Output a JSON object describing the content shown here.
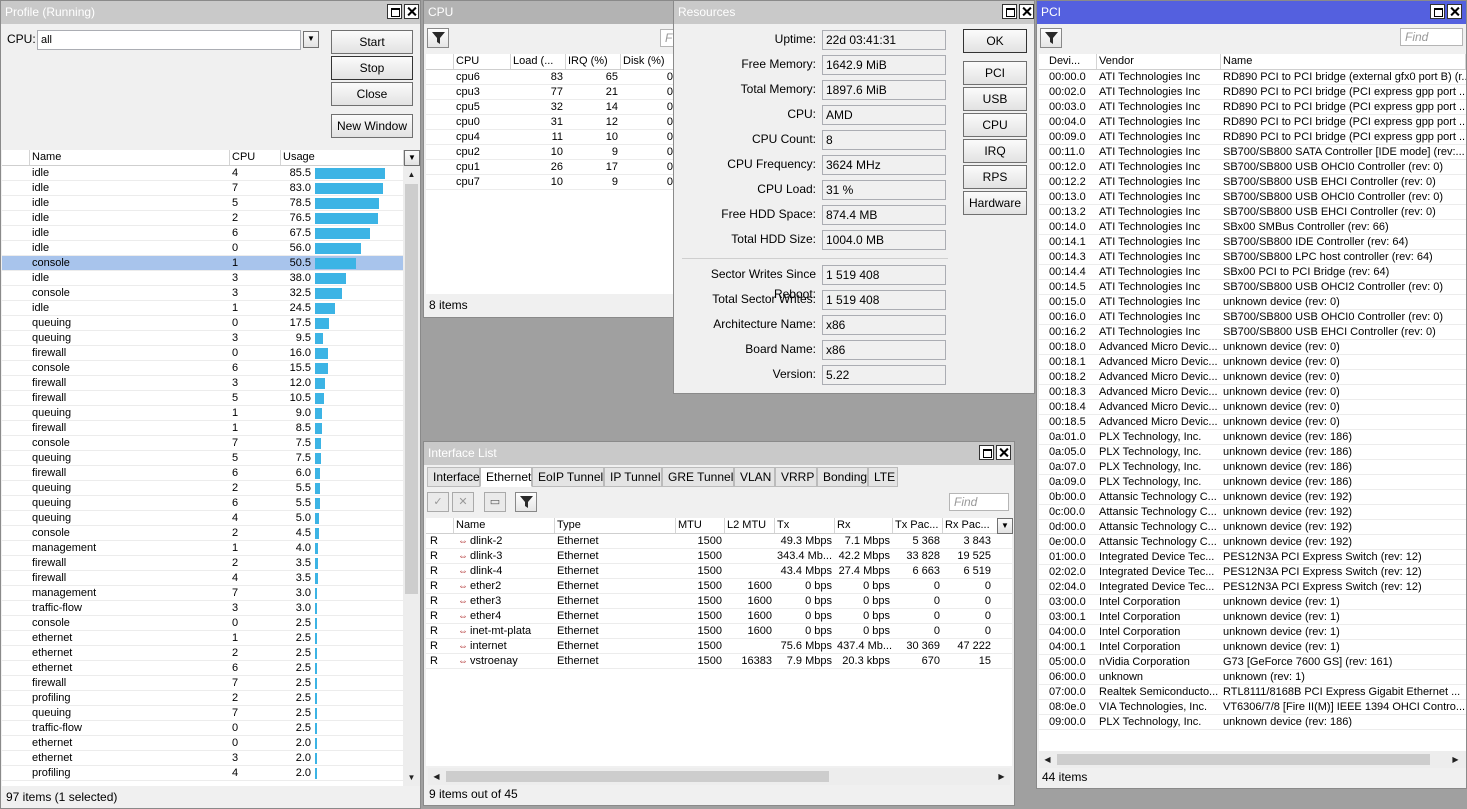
{
  "profile": {
    "title": "Profile (Running)",
    "cpu_label": "CPU:",
    "cpu_value": "all",
    "buttons": {
      "start": "Start",
      "stop": "Stop",
      "close": "Close",
      "new_window": "New Window"
    },
    "columns": [
      "Name",
      "CPU",
      "Usage"
    ],
    "rows": [
      [
        "idle",
        "4",
        "85.5"
      ],
      [
        "idle",
        "7",
        "83.0"
      ],
      [
        "idle",
        "5",
        "78.5"
      ],
      [
        "idle",
        "2",
        "76.5"
      ],
      [
        "idle",
        "6",
        "67.5"
      ],
      [
        "idle",
        "0",
        "56.0"
      ],
      [
        "console",
        "1",
        "50.5"
      ],
      [
        "idle",
        "3",
        "38.0"
      ],
      [
        "console",
        "3",
        "32.5"
      ],
      [
        "idle",
        "1",
        "24.5"
      ],
      [
        "queuing",
        "0",
        "17.5"
      ],
      [
        "queuing",
        "3",
        "9.5"
      ],
      [
        "firewall",
        "0",
        "16.0"
      ],
      [
        "console",
        "6",
        "15.5"
      ],
      [
        "firewall",
        "3",
        "12.0"
      ],
      [
        "firewall",
        "5",
        "10.5"
      ],
      [
        "queuing",
        "1",
        "9.0"
      ],
      [
        "firewall",
        "1",
        "8.5"
      ],
      [
        "console",
        "7",
        "7.5"
      ],
      [
        "queuing",
        "5",
        "7.5"
      ],
      [
        "firewall",
        "6",
        "6.0"
      ],
      [
        "queuing",
        "2",
        "5.5"
      ],
      [
        "queuing",
        "6",
        "5.5"
      ],
      [
        "queuing",
        "4",
        "5.0"
      ],
      [
        "console",
        "2",
        "4.5"
      ],
      [
        "management",
        "1",
        "4.0"
      ],
      [
        "firewall",
        "2",
        "3.5"
      ],
      [
        "firewall",
        "4",
        "3.5"
      ],
      [
        "management",
        "7",
        "3.0"
      ],
      [
        "traffic-flow",
        "3",
        "3.0"
      ],
      [
        "console",
        "0",
        "2.5"
      ],
      [
        "ethernet",
        "1",
        "2.5"
      ],
      [
        "ethernet",
        "2",
        "2.5"
      ],
      [
        "ethernet",
        "6",
        "2.5"
      ],
      [
        "firewall",
        "7",
        "2.5"
      ],
      [
        "profiling",
        "2",
        "2.5"
      ],
      [
        "queuing",
        "7",
        "2.5"
      ],
      [
        "traffic-flow",
        "0",
        "2.5"
      ],
      [
        "ethernet",
        "0",
        "2.0"
      ],
      [
        "ethernet",
        "3",
        "2.0"
      ],
      [
        "profiling",
        "4",
        "2.0"
      ]
    ],
    "status": "97 items (1 selected)"
  },
  "cpu": {
    "title": "CPU",
    "columns": [
      "CPU",
      "Load (...",
      "IRQ (%)",
      "Disk (%)"
    ],
    "rows": [
      [
        "cpu6",
        "83",
        "65",
        "0"
      ],
      [
        "cpu3",
        "77",
        "21",
        "0"
      ],
      [
        "cpu5",
        "32",
        "14",
        "0"
      ],
      [
        "cpu0",
        "31",
        "12",
        "0"
      ],
      [
        "cpu4",
        "11",
        "10",
        "0"
      ],
      [
        "cpu2",
        "10",
        "9",
        "0"
      ],
      [
        "cpu1",
        "26",
        "17",
        "0"
      ],
      [
        "cpu7",
        "10",
        "9",
        "0"
      ]
    ],
    "status": "8 items"
  },
  "resources": {
    "title": "Resources",
    "fields": [
      [
        "Uptime:",
        "22d 03:41:31"
      ],
      [
        "Free Memory:",
        "1642.9 MiB"
      ],
      [
        "Total Memory:",
        "1897.6 MiB"
      ],
      [
        "CPU:",
        "AMD"
      ],
      [
        "CPU Count:",
        "8"
      ],
      [
        "CPU Frequency:",
        "3624 MHz"
      ],
      [
        "CPU Load:",
        "31 %"
      ],
      [
        "Free HDD Space:",
        "874.4 MB"
      ],
      [
        "Total HDD Size:",
        "1004.0 MB"
      ]
    ],
    "fields2": [
      [
        "Sector Writes Since Reboot:",
        "1 519 408"
      ],
      [
        "Total Sector Writes:",
        "1 519 408"
      ],
      [
        "Architecture Name:",
        "x86"
      ],
      [
        "Board Name:",
        "x86"
      ],
      [
        "Version:",
        "5.22"
      ]
    ],
    "buttons": [
      "OK",
      "PCI",
      "USB",
      "CPU",
      "IRQ",
      "RPS",
      "Hardware"
    ]
  },
  "pci": {
    "title": "PCI",
    "find_placeholder": "Find",
    "columns": [
      "Devi...",
      "Vendor",
      "Name"
    ],
    "rows": [
      [
        "00:00.0",
        "ATI Technologies Inc",
        "RD890 PCI to PCI bridge (external gfx0 port B) (r..."
      ],
      [
        "00:02.0",
        "ATI Technologies Inc",
        "RD890 PCI to PCI bridge (PCI express gpp port ..."
      ],
      [
        "00:03.0",
        "ATI Technologies Inc",
        "RD890 PCI to PCI bridge (PCI express gpp port ..."
      ],
      [
        "00:04.0",
        "ATI Technologies Inc",
        "RD890 PCI to PCI bridge (PCI express gpp port ..."
      ],
      [
        "00:09.0",
        "ATI Technologies Inc",
        "RD890 PCI to PCI bridge (PCI express gpp port ..."
      ],
      [
        "00:11.0",
        "ATI Technologies Inc",
        "SB700/SB800 SATA Controller [IDE mode] (rev:..."
      ],
      [
        "00:12.0",
        "ATI Technologies Inc",
        "SB700/SB800 USB OHCI0 Controller (rev: 0)"
      ],
      [
        "00:12.2",
        "ATI Technologies Inc",
        "SB700/SB800 USB EHCI Controller (rev: 0)"
      ],
      [
        "00:13.0",
        "ATI Technologies Inc",
        "SB700/SB800 USB OHCI0 Controller (rev: 0)"
      ],
      [
        "00:13.2",
        "ATI Technologies Inc",
        "SB700/SB800 USB EHCI Controller (rev: 0)"
      ],
      [
        "00:14.0",
        "ATI Technologies Inc",
        "SBx00 SMBus Controller (rev: 66)"
      ],
      [
        "00:14.1",
        "ATI Technologies Inc",
        "SB700/SB800 IDE Controller (rev: 64)"
      ],
      [
        "00:14.3",
        "ATI Technologies Inc",
        "SB700/SB800 LPC host controller (rev: 64)"
      ],
      [
        "00:14.4",
        "ATI Technologies Inc",
        "SBx00 PCI to PCI Bridge (rev: 64)"
      ],
      [
        "00:14.5",
        "ATI Technologies Inc",
        "SB700/SB800 USB OHCI2 Controller (rev: 0)"
      ],
      [
        "00:15.0",
        "ATI Technologies Inc",
        "unknown device (rev: 0)"
      ],
      [
        "00:16.0",
        "ATI Technologies Inc",
        "SB700/SB800 USB OHCI0 Controller (rev: 0)"
      ],
      [
        "00:16.2",
        "ATI Technologies Inc",
        "SB700/SB800 USB EHCI Controller (rev: 0)"
      ],
      [
        "00:18.0",
        "Advanced Micro Devic...",
        "unknown device (rev: 0)"
      ],
      [
        "00:18.1",
        "Advanced Micro Devic...",
        "unknown device (rev: 0)"
      ],
      [
        "00:18.2",
        "Advanced Micro Devic...",
        "unknown device (rev: 0)"
      ],
      [
        "00:18.3",
        "Advanced Micro Devic...",
        "unknown device (rev: 0)"
      ],
      [
        "00:18.4",
        "Advanced Micro Devic...",
        "unknown device (rev: 0)"
      ],
      [
        "00:18.5",
        "Advanced Micro Devic...",
        "unknown device (rev: 0)"
      ],
      [
        "0a:01.0",
        "PLX Technology, Inc.",
        "unknown device (rev: 186)"
      ],
      [
        "0a:05.0",
        "PLX Technology, Inc.",
        "unknown device (rev: 186)"
      ],
      [
        "0a:07.0",
        "PLX Technology, Inc.",
        "unknown device (rev: 186)"
      ],
      [
        "0a:09.0",
        "PLX Technology, Inc.",
        "unknown device (rev: 186)"
      ],
      [
        "0b:00.0",
        "Attansic Technology C...",
        "unknown device (rev: 192)"
      ],
      [
        "0c:00.0",
        "Attansic Technology C...",
        "unknown device (rev: 192)"
      ],
      [
        "0d:00.0",
        "Attansic Technology C...",
        "unknown device (rev: 192)"
      ],
      [
        "0e:00.0",
        "Attansic Technology C...",
        "unknown device (rev: 192)"
      ],
      [
        "01:00.0",
        "Integrated Device Tec...",
        "PES12N3A PCI Express Switch (rev: 12)"
      ],
      [
        "02:02.0",
        "Integrated Device Tec...",
        "PES12N3A PCI Express Switch (rev: 12)"
      ],
      [
        "02:04.0",
        "Integrated Device Tec...",
        "PES12N3A PCI Express Switch (rev: 12)"
      ],
      [
        "03:00.0",
        "Intel Corporation",
        "unknown device (rev: 1)"
      ],
      [
        "03:00.1",
        "Intel Corporation",
        "unknown device (rev: 1)"
      ],
      [
        "04:00.0",
        "Intel Corporation",
        "unknown device (rev: 1)"
      ],
      [
        "04:00.1",
        "Intel Corporation",
        "unknown device (rev: 1)"
      ],
      [
        "05:00.0",
        "nVidia Corporation",
        "G73 [GeForce 7600 GS] (rev: 161)"
      ],
      [
        "06:00.0",
        "unknown",
        "unknown (rev: 1)"
      ],
      [
        "07:00.0",
        "Realtek Semiconducto...",
        "RTL8111/8168B PCI Express Gigabit Ethernet ..."
      ],
      [
        "08:0e.0",
        "VIA Technologies, Inc.",
        "VT6306/7/8 [Fire II(M)] IEEE 1394 OHCI Contro..."
      ],
      [
        "09:00.0",
        "PLX Technology, Inc.",
        "unknown device (rev: 186)"
      ]
    ],
    "status": "44 items"
  },
  "iface": {
    "title": "Interface List",
    "tabs": [
      "Interface",
      "Ethernet",
      "EoIP Tunnel",
      "IP Tunnel",
      "GRE Tunnel",
      "VLAN",
      "VRRP",
      "Bonding",
      "LTE"
    ],
    "find_placeholder": "Find",
    "columns": [
      "Name",
      "Type",
      "MTU",
      "L2 MTU",
      "Tx",
      "Rx",
      "Tx Pac...",
      "Rx Pac..."
    ],
    "rows": [
      [
        "R",
        "dlink-2",
        "Ethernet",
        "1500",
        "",
        "49.3 Mbps",
        "7.1 Mbps",
        "5 368",
        "3 843"
      ],
      [
        "R",
        "dlink-3",
        "Ethernet",
        "1500",
        "",
        "343.4 Mb...",
        "42.2 Mbps",
        "33 828",
        "19 525"
      ],
      [
        "R",
        "dlink-4",
        "Ethernet",
        "1500",
        "",
        "43.4 Mbps",
        "27.4 Mbps",
        "6 663",
        "6 519"
      ],
      [
        "R",
        "ether2",
        "Ethernet",
        "1500",
        "1600",
        "0 bps",
        "0 bps",
        "0",
        "0"
      ],
      [
        "R",
        "ether3",
        "Ethernet",
        "1500",
        "1600",
        "0 bps",
        "0 bps",
        "0",
        "0"
      ],
      [
        "R",
        "ether4",
        "Ethernet",
        "1500",
        "1600",
        "0 bps",
        "0 bps",
        "0",
        "0"
      ],
      [
        "R",
        "inet-mt-plata",
        "Ethernet",
        "1500",
        "1600",
        "0 bps",
        "0 bps",
        "0",
        "0"
      ],
      [
        "R",
        "internet",
        "Ethernet",
        "1500",
        "",
        "75.6 Mbps",
        "437.4 Mb...",
        "30 369",
        "47 222"
      ],
      [
        "R",
        "vstroenay",
        "Ethernet",
        "1500",
        "16383",
        "7.9 Mbps",
        "20.3 kbps",
        "670",
        "15"
      ]
    ],
    "status": "9 items out of 45"
  },
  "colors": {
    "active_title": "#5460df",
    "usage_bar": "#3cb4e5",
    "selection": "#a8c4ec"
  }
}
